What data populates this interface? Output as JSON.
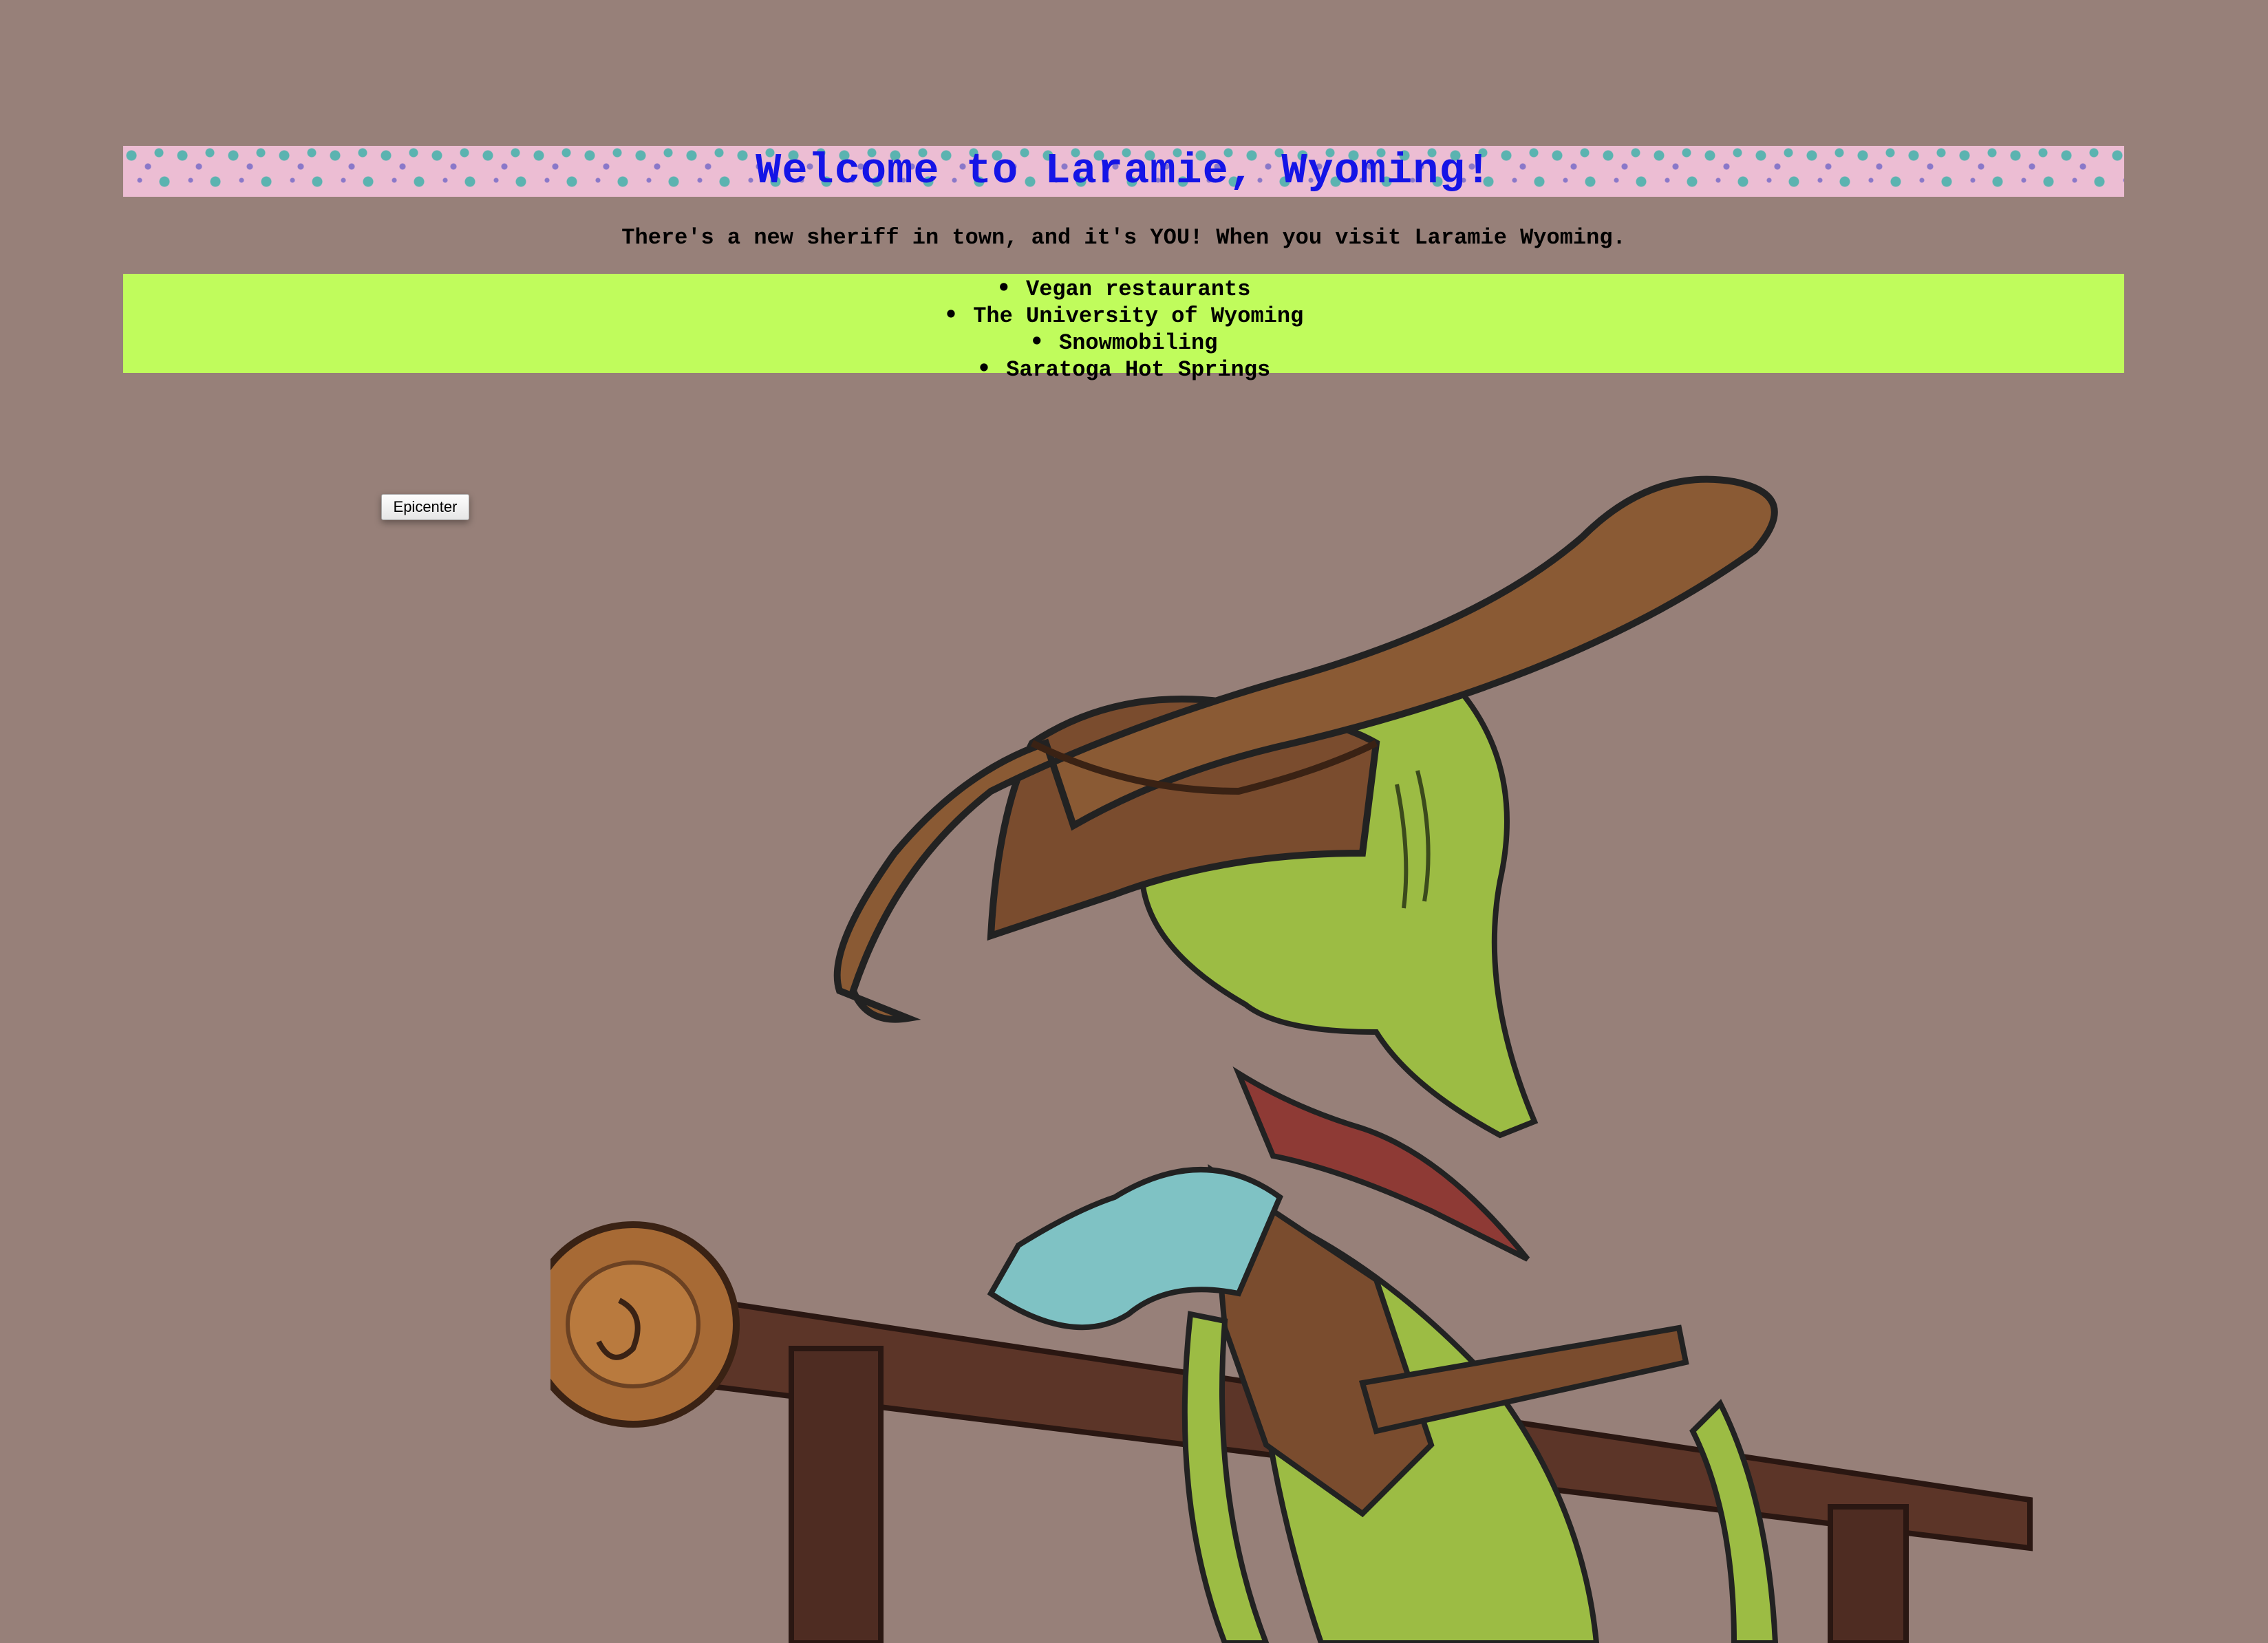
{
  "header": {
    "title": "Welcome to Laramie, Wyoming!"
  },
  "intro": {
    "text": "There's a new sheriff in town, and it's YOU! When you visit Laramie Wyoming."
  },
  "attractions": {
    "items": [
      "Vegan restaurants",
      "The University of Wyoming",
      "Snowmobiling",
      "Saratoga Hot Springs"
    ]
  },
  "button": {
    "label": "Epicenter"
  },
  "image": {
    "icon": "alien-cowboy-illustration"
  },
  "colors": {
    "page_background": "#978079",
    "banner_background": "#ecbdd3",
    "title_color": "#1414e6",
    "list_background": "#c0fc5c"
  }
}
